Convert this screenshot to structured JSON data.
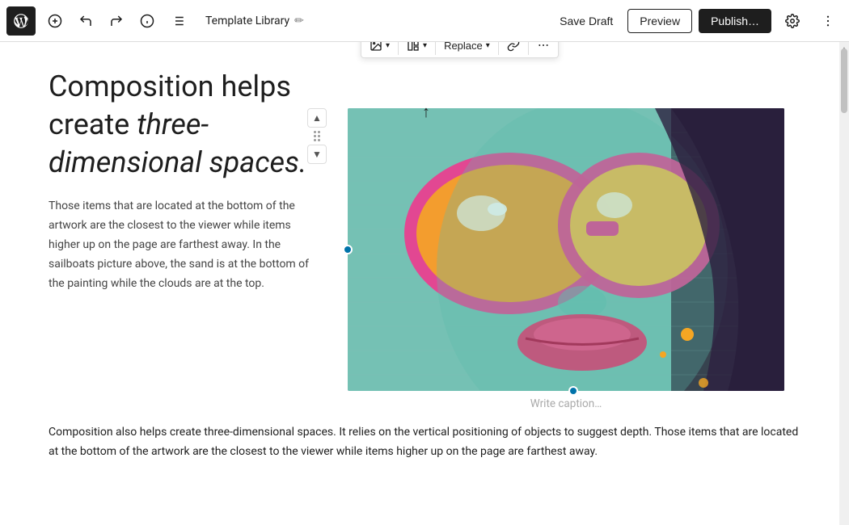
{
  "toolbar": {
    "title": "Template Library",
    "save_draft_label": "Save Draft",
    "preview_label": "Preview",
    "publish_label": "Publish…"
  },
  "image_toolbar": {
    "image_icon_label": "Image",
    "layout_label": "",
    "replace_label": "Replace",
    "link_label": "",
    "more_label": ""
  },
  "content": {
    "heading": "Composition helps create ",
    "heading_italic": "three-dimensional spaces.",
    "paragraph1": "Those items that are located at the bottom of the artwork are the closest to the viewer while items higher up on the page are farthest away. In the sailboats picture above, the sand is at the bottom of the painting while the clouds are at the top.",
    "caption": "Write caption…",
    "paragraph2": "Composition also helps create three-dimensional spaces. It relies on the vertical positioning of objects to suggest depth. Those items that are located at the bottom of the artwork are the closest to the viewer while items higher up on the page are farthest away."
  }
}
